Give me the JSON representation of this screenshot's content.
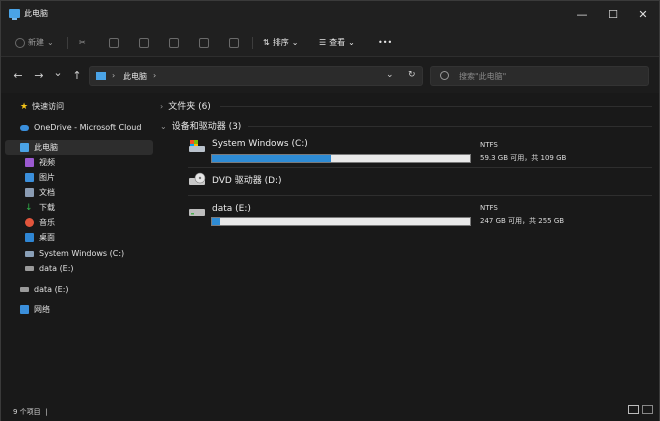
{
  "window": {
    "title": "此电脑",
    "minimize": "—",
    "maximize": "☐",
    "close": "✕"
  },
  "toolbar": {
    "new_label": "新建",
    "sort_label": "排序",
    "view_label": "查看",
    "more_label": "•••"
  },
  "nav": {
    "back": "←",
    "forward": "→",
    "recent": "⌄",
    "up": "↑",
    "refresh": "↻",
    "dropdown": "⌄"
  },
  "address": {
    "crumb": "此电脑",
    "sep": "›"
  },
  "search": {
    "placeholder": "搜索\"此电脑\""
  },
  "sidebar": {
    "items": [
      {
        "label": "快速访问",
        "icon": "star-icon",
        "color": "#f5c518"
      },
      {
        "label": "OneDrive - Microsoft Cloud",
        "icon": "cloud-icon",
        "color": "#3a8fdc"
      },
      {
        "label": "此电脑",
        "icon": "computer-icon",
        "color": "#4aa3e6"
      },
      {
        "label": "视频",
        "icon": "video-icon",
        "color": "#9b59d0"
      },
      {
        "label": "图片",
        "icon": "pictures-icon",
        "color": "#3b8fdb"
      },
      {
        "label": "文档",
        "icon": "documents-icon",
        "color": "#8b9cb3"
      },
      {
        "label": "下载",
        "icon": "download-icon",
        "color": "#2fb34a"
      },
      {
        "label": "音乐",
        "icon": "music-icon",
        "color": "#e2553c"
      },
      {
        "label": "桌面",
        "icon": "desktop-icon",
        "color": "#2f86d4"
      },
      {
        "label": "System Windows (C:)",
        "icon": "system-drive-icon",
        "color": "#8aa0b8"
      },
      {
        "label": "data (E:)",
        "icon": "drive-icon",
        "color": "#9a9a9a"
      },
      {
        "label": "data (E:)",
        "icon": "drive-icon",
        "color": "#9a9a9a"
      },
      {
        "label": "网络",
        "icon": "network-icon",
        "color": "#3b8fdb"
      }
    ]
  },
  "main": {
    "folders_group": "文件夹 (6)",
    "drives_group": "设备和驱动器 (3)",
    "drives": [
      {
        "name": "System Windows (C:)",
        "fs": "NTFS",
        "space": "59.3 GB 可用，共 109 GB",
        "used_fraction": 0.46,
        "icon": "system-drive-icon"
      },
      {
        "name": "DVD 驱动器 (D:)",
        "fs": "",
        "space": "",
        "icon": "dvd-drive-icon"
      },
      {
        "name": "data (E:)",
        "fs": "NTFS",
        "space": "247 GB 可用，共 255 GB",
        "used_fraction": 0.03,
        "icon": "drive-icon"
      }
    ]
  },
  "status": {
    "count": "9 个项目",
    "sep": "|"
  }
}
